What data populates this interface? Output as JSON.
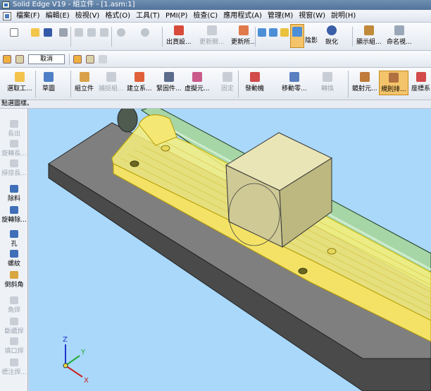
{
  "window": {
    "title": "Solid Edge V19 - 組立件 - [1.asm:1]"
  },
  "menu": [
    "檔案(F)",
    "編輯(E)",
    "檢視(V)",
    "格式(O)",
    "工具(T)",
    "PMI(P)",
    "檢查(C)",
    "應用程式(A)",
    "管理(M)",
    "視窗(W)",
    "說明(H)"
  ],
  "toolbar1": {
    "labels": [
      "出貨設...",
      "更新關...",
      "更新所...",
      "陰影",
      "銳化",
      "顯示組...",
      "命名視..."
    ]
  },
  "toolbar2": {
    "cancel_label": "取消"
  },
  "toolbar3": {
    "labels": [
      "選取工...",
      "草圖",
      "組立件",
      "捕捉組...",
      "建立系...",
      "緊固件...",
      "虛擬元...",
      "固定",
      "發動機",
      "移動零...",
      "轉換",
      "鏡射元...",
      "規則排...",
      "座標系"
    ]
  },
  "status": {
    "prompt": "點選圖樣。"
  },
  "features": {
    "labels": [
      "長出",
      "旋轉長...",
      "掃掠長...",
      "除料",
      "旋轉除...",
      "孔",
      "螺紋",
      "倒斜角",
      "角焊",
      "斷續焊",
      "填口焊",
      "標注焊..."
    ]
  },
  "axes": {
    "x": "X",
    "y": "Y",
    "z": "Z"
  },
  "colors": {
    "viewport_bg": "#a9d8fa",
    "highlight": "#f7f07c",
    "shaft": "#a7d6a6"
  }
}
